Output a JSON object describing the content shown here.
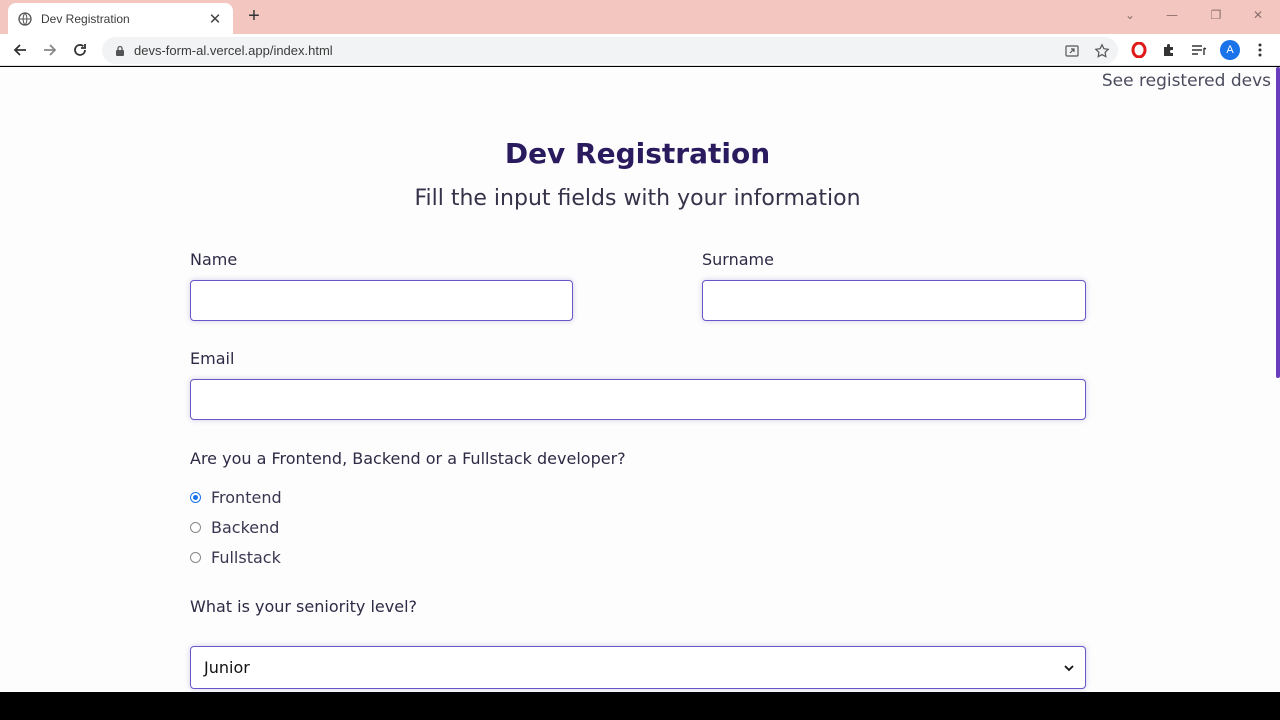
{
  "browser": {
    "tab_title": "Dev Registration",
    "tab_close": "✕",
    "new_tab": "+",
    "url": "devs-form-al.vercel.app/index.html",
    "avatar_initial": "A",
    "window_controls": [
      "⌄",
      "—",
      "❐",
      "✕"
    ]
  },
  "page": {
    "top_link": "See registered devs",
    "title": "Dev Registration",
    "subtitle": "Fill the input fields with your information",
    "form": {
      "name_label": "Name",
      "name_value": "",
      "surname_label": "Surname",
      "surname_value": "",
      "email_label": "Email",
      "email_value": "",
      "dev_type_question": "Are you a Frontend, Backend or a Fullstack developer?",
      "dev_type_options": [
        {
          "label": "Frontend",
          "checked": true
        },
        {
          "label": "Backend",
          "checked": false
        },
        {
          "label": "Fullstack",
          "checked": false
        }
      ],
      "seniority_question": "What is your seniority level?",
      "seniority_selected": "Junior"
    }
  },
  "colors": {
    "tab_strip": "#f3c7c0",
    "heading": "#2a1a5e",
    "field_border": "#6b55c8",
    "radio_checked": "#1a73e8",
    "scrollbar": "#6a3dbf"
  }
}
